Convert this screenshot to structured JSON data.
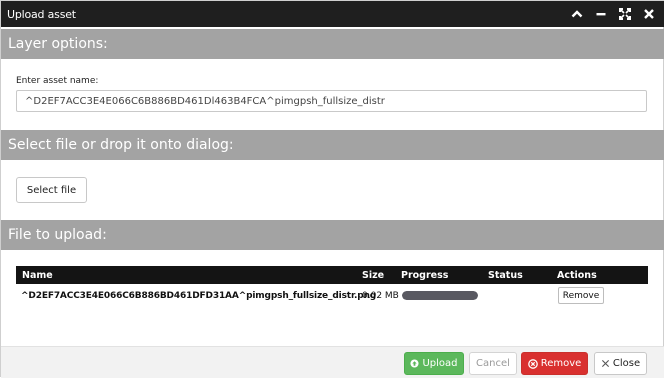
{
  "dialog": {
    "title": "Upload asset"
  },
  "sections": {
    "layer_options": "Layer options:",
    "select_file": "Select file or drop it onto dialog:",
    "file_to_upload": "File to upload:"
  },
  "asset": {
    "label": "Enter asset name:",
    "value": "^D2EF7ACC3E4E066C6B886BD461Dl463B4FCA^pimgpsh_fullsize_distr"
  },
  "select_file_button": "Select file",
  "table": {
    "headers": {
      "name": "Name",
      "size": "Size",
      "progress": "Progress",
      "status": "Status",
      "actions": "Actions"
    },
    "rows": [
      {
        "name": "^D2EF7ACC3E4E066C6B886BD461DFD31AA^pimgpsh_fullsize_distr.png",
        "size": "0.02 MB",
        "progress_percent": 100,
        "status": "",
        "action_label": "Remove"
      }
    ]
  },
  "footer": {
    "upload": "Upload",
    "cancel": "Cancel",
    "remove": "Remove",
    "close": "Close"
  },
  "icons": {
    "titlebar": [
      "chevron-up-icon",
      "minimize-icon",
      "fullscreen-icon",
      "close-icon"
    ],
    "upload": "circle-arrow-up-icon",
    "remove": "circle-x-icon",
    "close": "x-icon"
  },
  "colors": {
    "titlebar": "#1f1f1f",
    "section_header": "#a3a3a3",
    "upload_button": "#5cb85c",
    "remove_button": "#d9302f",
    "progress_fill": "#595961"
  }
}
